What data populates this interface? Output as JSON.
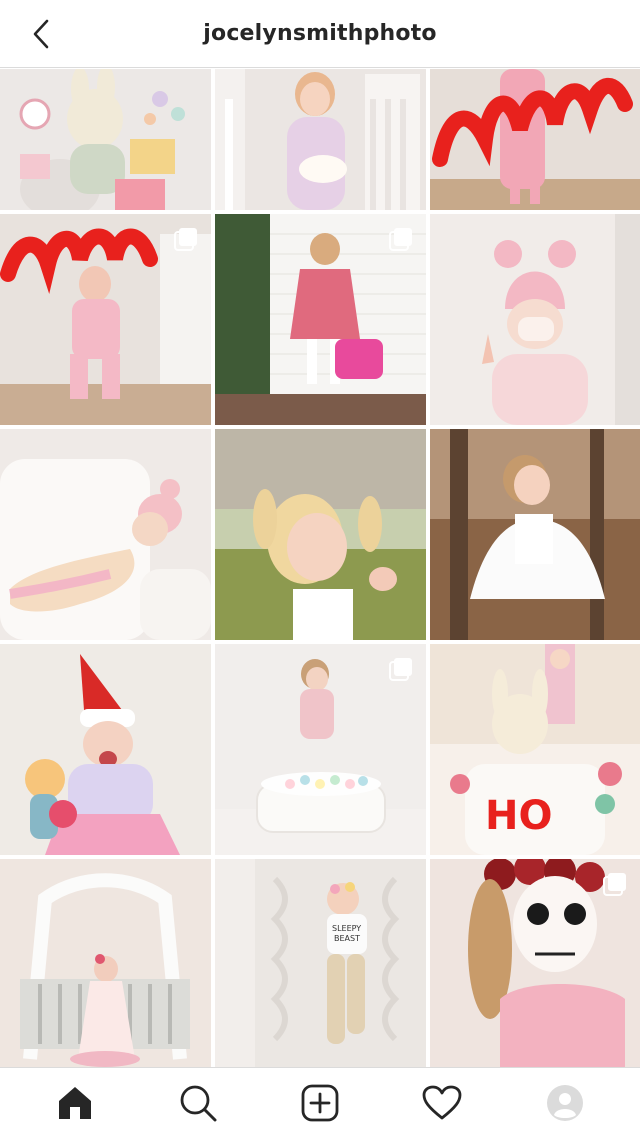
{
  "header": {
    "username": "jocelynsmithphoto",
    "back_icon": "chevron-left-icon"
  },
  "posts": [
    {
      "id": "p1",
      "subject": "bunny plush and toys flatlay",
      "multiple": false
    },
    {
      "id": "p2",
      "subject": "girl in crib with cloud lamp",
      "multiple": false
    },
    {
      "id": "p3",
      "subject": "girl holding red love balloon",
      "multiple": false
    },
    {
      "id": "p4",
      "subject": "girl with love balloon in pink jumpsuit",
      "multiple": true
    },
    {
      "id": "p5",
      "subject": "girl in gingham dress by brick wall",
      "multiple": true
    },
    {
      "id": "p6",
      "subject": "girl in pink pom beanie with mask",
      "multiple": false
    },
    {
      "id": "p7",
      "subject": "girl lounging on white chair in beanie",
      "multiple": false
    },
    {
      "id": "p8",
      "subject": "girl with pigtails in field",
      "multiple": false
    },
    {
      "id": "p9",
      "subject": "girl twirling white dress in woods",
      "multiple": false
    },
    {
      "id": "p10",
      "subject": "girl in santa hat with dolls",
      "multiple": false
    },
    {
      "id": "p11",
      "subject": "girl in ball pit",
      "multiple": true
    },
    {
      "id": "p12",
      "subject": "bunny plush with HO stocking",
      "multiple": false
    },
    {
      "id": "p13",
      "subject": "girl in canopy crib",
      "multiple": false
    },
    {
      "id": "p14",
      "subject": "baby in sleepy beast shirt on blanket",
      "multiple": false
    },
    {
      "id": "p15",
      "subject": "girl with sugar skull face paint",
      "multiple": true
    }
  ],
  "bottom_nav": [
    {
      "name": "home-icon",
      "active": true
    },
    {
      "name": "search-icon",
      "active": false
    },
    {
      "name": "new-post-icon",
      "active": false
    },
    {
      "name": "heart-icon",
      "active": false
    },
    {
      "name": "profile-avatar-icon",
      "active": false
    }
  ],
  "colors": {
    "text": "#262626",
    "border": "#dbdbdb",
    "love_red": "#e8211d",
    "pink": "#f3b8c4"
  }
}
